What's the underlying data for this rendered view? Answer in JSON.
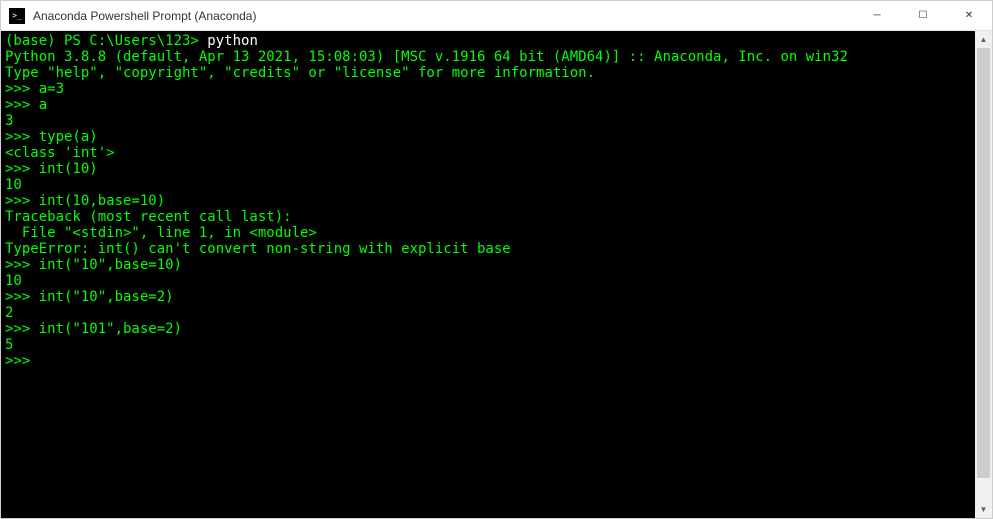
{
  "titlebar": {
    "title": "Anaconda Powershell Prompt (Anaconda)"
  },
  "terminal": {
    "line1_prefix": "(base) PS C:\\Users\\123> ",
    "line1_cmd": "python",
    "line2": "Python 3.8.8 (default, Apr 13 2021, 15:08:03) [MSC v.1916 64 bit (AMD64)] :: Anaconda, Inc. on win32",
    "line3": "Type \"help\", \"copyright\", \"credits\" or \"license\" for more information.",
    "line4": ">>> a=3",
    "line5": ">>> a",
    "line6": "3",
    "line7": ">>> type(a)",
    "line8": "<class 'int'>",
    "line9": ">>> int(10)",
    "line10": "10",
    "line11": ">>> int(10,base=10)",
    "line12": "Traceback (most recent call last):",
    "line13": "  File \"<stdin>\", line 1, in <module>",
    "line14": "TypeError: int() can't convert non-string with explicit base",
    "line15": ">>> int(\"10\",base=10)",
    "line16": "10",
    "line17": ">>> int(\"10\",base=2)",
    "line18": "2",
    "line19": ">>> int(\"101\",base=2)",
    "line20": "5",
    "line21": ">>> "
  },
  "controls": {
    "minimize": "─",
    "maximize": "☐",
    "close": "✕"
  },
  "scrollbar": {
    "up": "▲",
    "down": "▼"
  }
}
